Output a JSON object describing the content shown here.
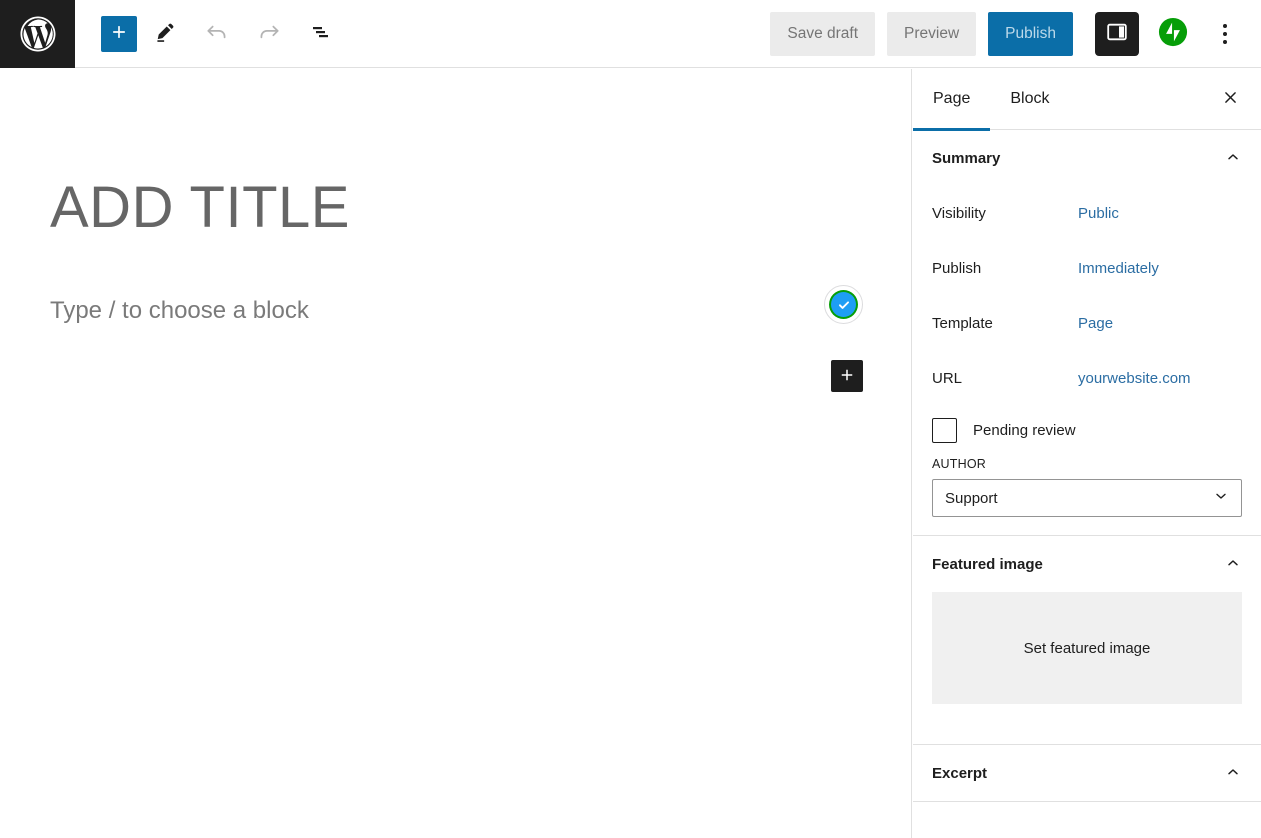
{
  "toolbar": {
    "wp_logo_name": "wordpress-logo",
    "add_block_label": "+",
    "tools": [
      {
        "name": "add-block-button",
        "label": "+"
      },
      {
        "name": "edit-tool-button",
        "label": ""
      },
      {
        "name": "undo-button",
        "label": ""
      },
      {
        "name": "redo-button",
        "label": ""
      },
      {
        "name": "document-overview-button",
        "label": ""
      }
    ],
    "save_draft_label": "Save draft",
    "preview_label": "Preview",
    "publish_label": "Publish",
    "settings_toggle_name": "settings-sidebar-toggle",
    "jetpack_name": "jetpack-icon",
    "options_name": "more-options-button"
  },
  "editor": {
    "title_placeholder": "ADD TITLE",
    "body_placeholder": "Type / to choose a block",
    "inserter_label": "+",
    "status_badge_glyph": "✓"
  },
  "sidebar": {
    "tabs": [
      {
        "label": "Page",
        "active": true
      },
      {
        "label": "Block",
        "active": false
      }
    ],
    "close_label": "✕",
    "summary": {
      "title": "Summary",
      "chevron": "⌃",
      "rows": [
        {
          "label": "Visibility",
          "value": "Public"
        },
        {
          "label": "Publish",
          "value": "Immediately"
        },
        {
          "label": "Template",
          "value": "Page"
        },
        {
          "label": "URL",
          "value": "yourwebsite.com"
        }
      ],
      "pending_review_label": "Pending review",
      "author_label": "AUTHOR",
      "author_value": "Support",
      "author_chevron": "⌄"
    },
    "featured_image": {
      "title": "Featured image",
      "chevron": "⌃",
      "placeholder_label": "Set featured image"
    },
    "excerpt": {
      "title": "Excerpt",
      "chevron": "⌃"
    }
  },
  "colors": {
    "accent_blue": "#0b6ea8",
    "link_blue": "#2b6da3",
    "dark": "#1e1e1e",
    "jetpack_green": "#069e08",
    "badge_blue": "#1e9ef4"
  }
}
